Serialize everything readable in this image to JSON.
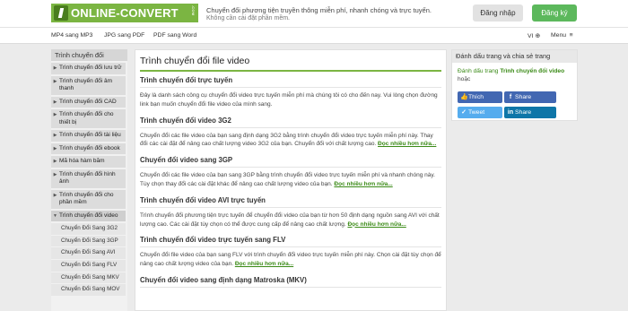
{
  "header": {
    "logo_text": "ONLINE-CONVERT",
    "logo_suffix": ".COM",
    "tagline": "Chuyển đổi phương tiện truyền thông miễn phí, nhanh chóng và trực tuyến.",
    "tagline_sub": "Không cần cài đặt phần mềm.",
    "login_label": "Đăng nhập",
    "signup_label": "Đăng ký"
  },
  "nav": {
    "links": [
      "MP4 sang MP3",
      "JPG sang PDF",
      "PDF sang Word"
    ],
    "language": "VI",
    "menu_label": "Menu"
  },
  "sidebar": {
    "title": "Trình chuyển đổi",
    "items": [
      "Trình chuyển đổi lưu trữ",
      "Trình chuyển đổi âm thanh",
      "Trình chuyển đổi CAD",
      "Trình chuyển đổi cho thiết bị",
      "Trình chuyển đổi tài liệu",
      "Trình chuyển đổi ebook",
      "Mã hóa hàm băm",
      "Trình chuyển đổi hình ảnh",
      "Trình chuyển đổi cho phần mềm",
      "Trình chuyển đổi video"
    ],
    "subitems": [
      "Chuyển Đổi Sang 3G2",
      "Chuyển Đổi Sang 3GP",
      "Chuyển Đổi Sang AVI",
      "Chuyển Đổi Sang FLV",
      "Chuyển Đổi Sang MKV",
      "Chuyển Đổi Sang MOV"
    ]
  },
  "main": {
    "title": "Trình chuyển đổi file video",
    "more_link": "Đọc nhiều hơn nữa...",
    "sections": [
      {
        "heading": "Trình chuyển đổi trực tuyến",
        "text": "Đây là danh sách công cụ chuyển đổi video trực tuyến miễn phí mà chúng tôi có cho đến nay. Vui lòng chọn đường link bạn muốn chuyển đổi file video của mình sang."
      },
      {
        "heading": "Trình chuyển đổi video 3G2",
        "text": "Chuyển đổi các file video của bạn sang định dạng 3G2 bằng trình chuyển đổi video trực tuyến miễn phí này. Thay đổi các cài đặt để nâng cao chất lượng video 3G2 của bạn. Chuyển đổi với chất lượng cao."
      },
      {
        "heading": "Chuyển đổi video sang 3GP",
        "text": "Chuyển đổi các file video của bạn sang 3GP bằng trình chuyển đổi video trực tuyến miễn phí và nhanh chóng này. Tùy chọn thay đổi các cài đặt khác để nâng cao chất lượng video của bạn."
      },
      {
        "heading": "Trình chuyển đổi video AVI trực tuyến",
        "text": "Trình chuyển đổi phương tiện trực tuyến để chuyển đổi video của bạn từ hơn 50 định dạng nguồn sang AVI với chất lượng cao. Các cài đặt tùy chọn có thể được cung cấp để nâng cao chất lượng."
      },
      {
        "heading": "Trình chuyển đổi video trực tuyến sang FLV",
        "text": "Chuyển đổi file video của bạn sang FLV với trình chuyển đổi video trực tuyến miễn phí này. Chọn cài đặt tùy chọn để nâng cao chất lượng video của bạn."
      },
      {
        "heading": "Chuyển đổi video sang định dạng Matroska (MKV)",
        "text": ""
      }
    ]
  },
  "bookmark": {
    "title": "Đánh dấu trang và chia sẻ trang",
    "text_prefix": "Đánh dấu trang",
    "text_link": "Trình chuyển đổi video",
    "text_suffix": "hoặc",
    "share": {
      "facebook_like": "Thích",
      "facebook_share": "Share",
      "tweet": "Tweet",
      "linkedin_share": "Share"
    }
  },
  "colors": {
    "brand_green": "#7bb542",
    "signup_green": "#5cb85c",
    "link_green": "#3a8a16",
    "facebook": "#4267b2",
    "twitter": "#55acee",
    "linkedin": "#0e76a8"
  }
}
